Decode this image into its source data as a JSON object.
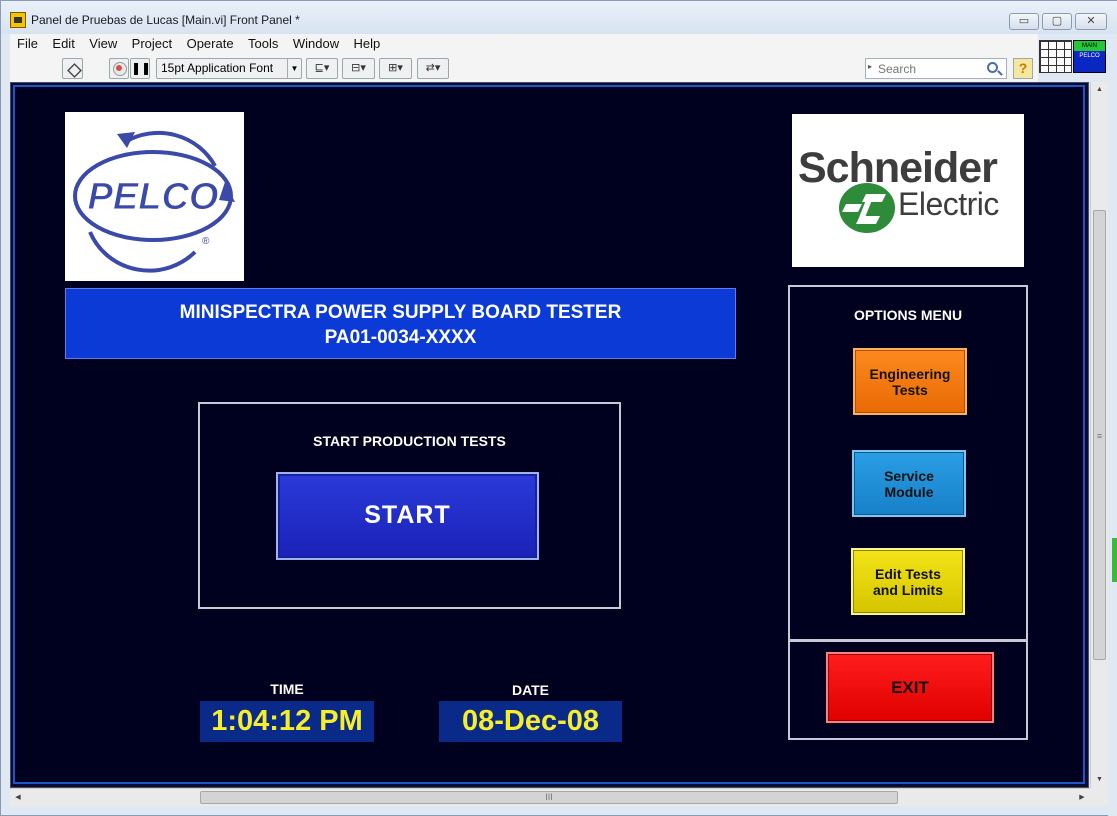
{
  "window": {
    "title": "Panel de Pruebas de Lucas [Main.vi] Front Panel *",
    "controls": {
      "minimize": "▭",
      "maximize": "▢",
      "close": "✕"
    }
  },
  "menubar": {
    "items": [
      "File",
      "Edit",
      "View",
      "Project",
      "Operate",
      "Tools",
      "Window",
      "Help"
    ]
  },
  "toolbar": {
    "pause": "❚❚",
    "font": "15pt Application Font",
    "dropdown_arrow": "▼",
    "align_glyph": "⊑▾",
    "distribute_glyph": "⊟▾",
    "resize_glyph": "⊞▾",
    "reorder_glyph": "⇄▾",
    "search_lead": "▸",
    "search_placeholder": "Search",
    "help": "?"
  },
  "vi_icon": {
    "top": "MAIN",
    "bottom": "PELCO"
  },
  "logos": {
    "pelco": "PELCO",
    "pelco_registered": "®",
    "schneider_name": "Schneider",
    "schneider_sub": "Electric"
  },
  "banner": {
    "line1": "MINISPECTRA POWER SUPPLY BOARD TESTER",
    "line2": "PA01-0034-XXXX"
  },
  "start_section": {
    "label": "START PRODUCTION TESTS",
    "button": "START"
  },
  "time": {
    "label": "TIME",
    "value": "1:04:12 PM"
  },
  "date": {
    "label": "DATE",
    "value": "08-Dec-08"
  },
  "options": {
    "title": "OPTIONS MENU",
    "engineering": "Engineering\nTests",
    "service": "Service\nModule",
    "edit": "Edit Tests\nand Limits",
    "exit": "EXIT"
  },
  "scrollbars": {
    "up": "▲",
    "down": "▼",
    "left": "◀",
    "right": "▶",
    "v_grip": "≡",
    "h_grip": "III"
  },
  "colors": {
    "panel_bg": "#00001f",
    "banner": "#0c3ad6",
    "display_text": "#f6ee2a",
    "engineering": "#fd8a1e",
    "service": "#2a9ee4",
    "edit": "#f3e418",
    "exit": "#ff1c1c"
  }
}
